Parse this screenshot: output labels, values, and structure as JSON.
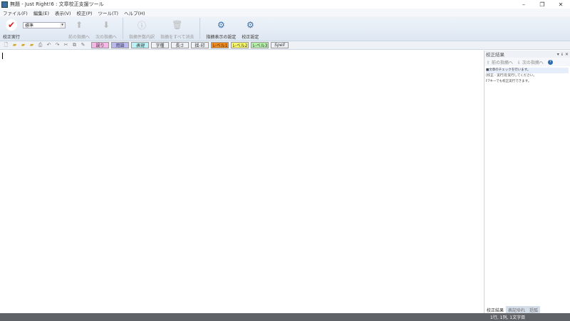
{
  "window": {
    "title": "無題 - Just Right!6 : 文章校正支援ツール",
    "minimize": "–",
    "maximize": "❐",
    "close": "✕"
  },
  "menu": [
    "ファイル(F)",
    "編集(E)",
    "表示(V)",
    "校正(P)",
    "ツール(T)",
    "ヘルプ(H)"
  ],
  "ribbon": {
    "check": "校正実行",
    "combo": "標準",
    "prev": "前の指摘へ",
    "next": "次の指摘へ",
    "breakdown": "指摘件数内訳",
    "clear": "指摘をすべて消去",
    "display_settings": "指摘表示の設定",
    "settings": "校正設定"
  },
  "tags": [
    {
      "label": "誤り",
      "bg": "#f7b6e6"
    },
    {
      "label": "用語",
      "bg": "#b9b9f2"
    },
    {
      "label": "表現",
      "bg": "#b7f3f7"
    },
    {
      "label": "字種",
      "bg": "#ffffff"
    },
    {
      "label": "長さ",
      "bg": "#ffffff"
    },
    {
      "label": "揺-印",
      "bg": "#ffffff"
    },
    {
      "label": "レベル1",
      "bg": "#f08a1c"
    },
    {
      "label": "レベル2",
      "bg": "#f7f76a"
    },
    {
      "label": "レベル3",
      "bg": "#b4f0a8"
    },
    {
      "label": "Spell",
      "bg": "#ffffff"
    }
  ],
  "panel": {
    "title": "校正結果",
    "prev": "前の指摘へ",
    "next": "次の指摘へ",
    "lines": [
      "■文章のチェックを行います。",
      "[校正 - 実行]を実行してください。",
      "F7キーでも校正実行できます。"
    ],
    "tabs": [
      "校正結果",
      "表記ゆれ",
      "括弧"
    ]
  },
  "status": {
    "position": "1行, 1列, 1文字目"
  }
}
